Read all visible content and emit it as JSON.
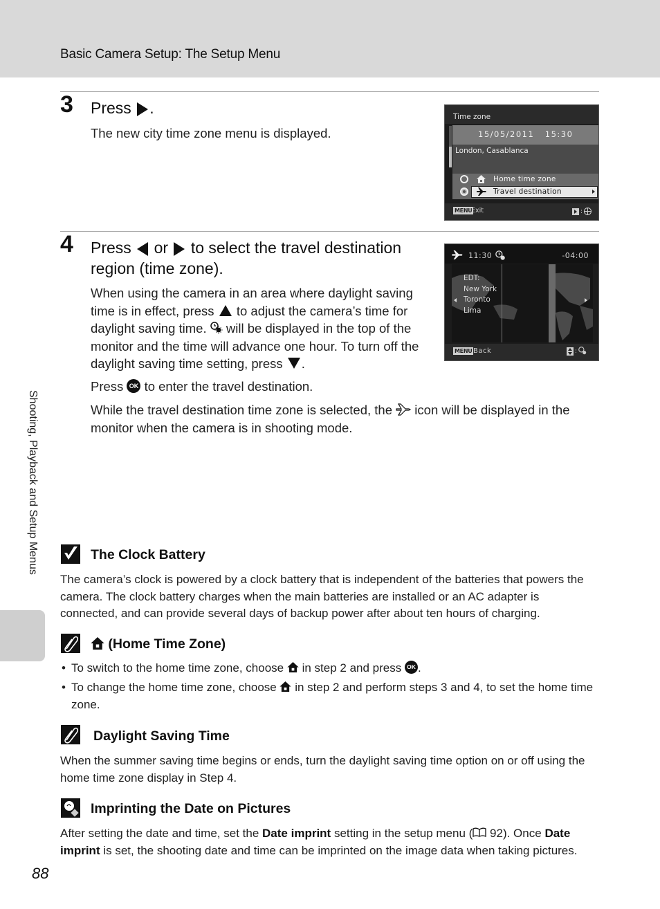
{
  "header": {
    "title": "Basic Camera Setup: The Setup Menu"
  },
  "side_tab": {
    "label": "Shooting, Playback and Setup Menus"
  },
  "steps": [
    {
      "number": "3",
      "title_prefix": "Press",
      "title_suffix": ".",
      "title_icon": "right-arrow-button-icon",
      "body": "The new city time zone menu is displayed."
    },
    {
      "number": "4",
      "title_part1": "Press",
      "title_part2": "or",
      "title_part3": "to select the travel destination",
      "title_line2": "region (time zone).",
      "para1_a": "When using the camera in an area where daylight saving time is in effect, press",
      "para1_b": "to adjust the camera’s time for daylight saving time.",
      "para1_c": "will be displayed in the top of the monitor and the time will advance one hour. To turn off the daylight saving time setting, press",
      "para1_d": ".",
      "para2_a": "Press",
      "para2_b": "to enter the travel destination.",
      "para3_a": "While the travel destination time zone is selected, the",
      "para3_b": "icon will be displayed in the monitor when the camera is in shooting mode."
    }
  ],
  "camera_screen_1": {
    "title": "Time zone",
    "datetime": "15/05/2011   15:30",
    "city": "London, Casablanca",
    "options": [
      {
        "label": "Home time zone",
        "icon": "home-icon",
        "selected": false
      },
      {
        "label": "Travel destination",
        "icon": "plane-icon",
        "selected": true
      }
    ],
    "footer_menu_badge": "MENU",
    "footer_left": "Exit"
  },
  "camera_screen_2": {
    "time": "11:30",
    "offset": "-04:00",
    "zone_label": "EDT:",
    "cities": [
      "New York",
      "Toronto",
      "Lima"
    ],
    "footer_menu_badge": "MENU",
    "footer_left": "Back"
  },
  "notes": {
    "clock_battery": {
      "icon": "check-icon",
      "title": "The Clock Battery",
      "body": "The camera’s clock is powered by a clock battery that is independent of the batteries that powers the camera. The clock battery charges when the main batteries are installed or an AC adapter is connected, and can provide several days of backup power after about ten hours of charging."
    },
    "home_time_zone": {
      "icon": "paperclip-icon",
      "title": "(Home Time Zone)",
      "bullets": [
        {
          "a": "To switch to the home time zone, choose",
          "b": "in step 2 and press",
          "c": "."
        },
        {
          "a": "To change the home time zone, choose",
          "b": "in step 2 and perform steps 3 and 4, to set the home time zone."
        }
      ]
    },
    "daylight_saving": {
      "icon": "paperclip-icon",
      "title": "Daylight Saving Time",
      "body": "When the summer saving time begins or ends, turn the daylight saving time option on or off using the home time zone display in Step 4."
    },
    "imprinting": {
      "icon": "lightbulb-tip-icon",
      "title": "Imprinting the Date on Pictures",
      "body_a": "After setting the date and time, set the",
      "kw1": "Date imprint",
      "body_b": "setting in the setup menu (",
      "page_ref": "92",
      "body_c": "). Once",
      "kw2": "Date imprint",
      "body_d": "is set, the shooting date and time can be imprinted on the image data when taking pictures."
    }
  },
  "ok_label": "OK",
  "page_number": "88"
}
